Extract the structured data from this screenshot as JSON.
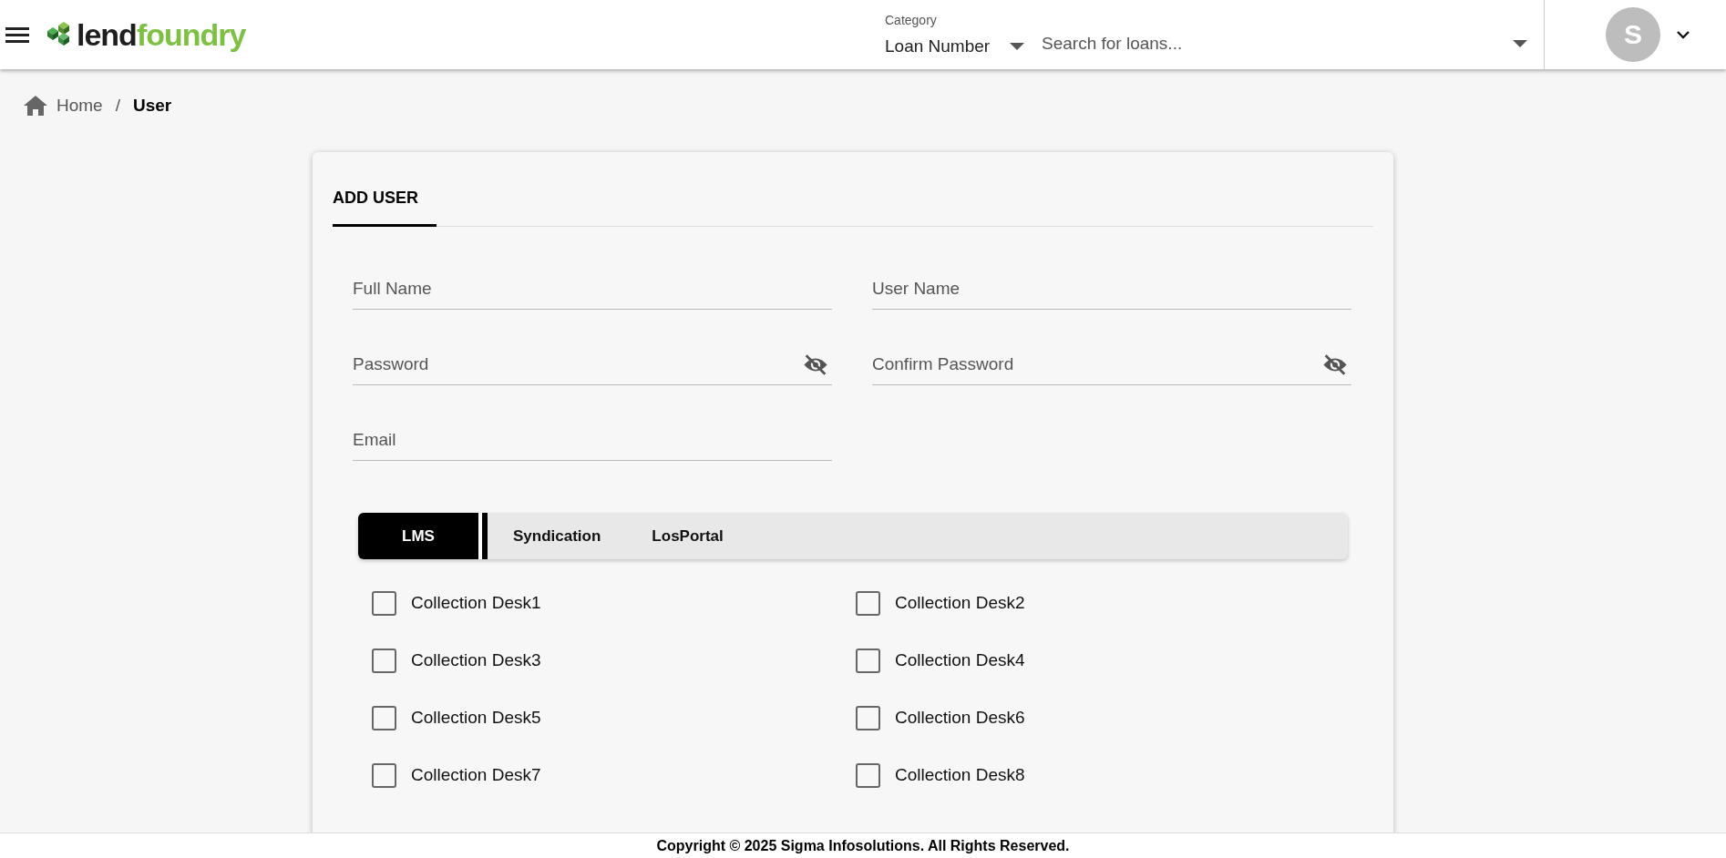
{
  "header": {
    "logo": {
      "part_1": "lend",
      "part_2": "foundry"
    },
    "category": {
      "label": "Category",
      "value": "Loan Number"
    },
    "search": {
      "placeholder": "Search for loans..."
    },
    "avatar": "S"
  },
  "breadcrumb": {
    "home": "Home",
    "separator": "/",
    "current": "User"
  },
  "card": {
    "tabs": [
      {
        "label": "ADD USER",
        "selected": true
      }
    ],
    "fields": [
      {
        "placeholder": "Full Name",
        "kind": "text"
      },
      {
        "placeholder": "User Name",
        "kind": "text"
      },
      {
        "placeholder": "Password",
        "kind": "password"
      },
      {
        "placeholder": "Confirm Password",
        "kind": "password"
      },
      {
        "placeholder": "Email",
        "kind": "text"
      }
    ],
    "role_tabs": [
      {
        "label": "LMS",
        "selected": true
      },
      {
        "label": "Syndication",
        "selected": false
      },
      {
        "label": "LosPortal",
        "selected": false
      }
    ],
    "roles": [
      {
        "label": "Collection Desk1",
        "checked": false
      },
      {
        "label": "Collection Desk2",
        "checked": false
      },
      {
        "label": "Collection Desk3",
        "checked": false
      },
      {
        "label": "Collection Desk4",
        "checked": false
      },
      {
        "label": "Collection Desk5",
        "checked": false
      },
      {
        "label": "Collection Desk6",
        "checked": false
      },
      {
        "label": "Collection Desk7",
        "checked": false
      },
      {
        "label": "Collection Desk8",
        "checked": false
      }
    ]
  },
  "footer": "Copyright © 2025 Sigma Infosolutions. All Rights Reserved."
}
